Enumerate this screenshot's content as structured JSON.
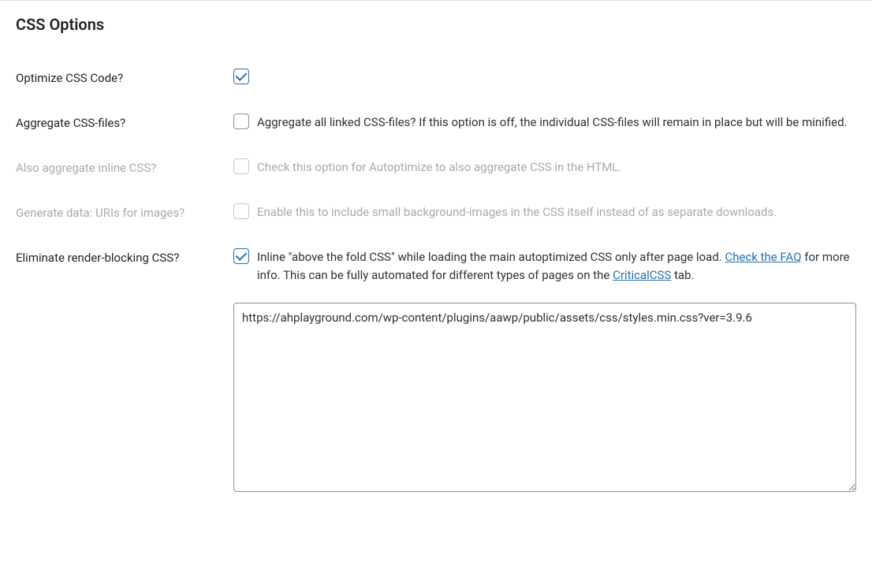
{
  "section": {
    "title": "CSS Options"
  },
  "rows": {
    "optimize": {
      "label": "Optimize CSS Code?"
    },
    "aggregate": {
      "label": "Aggregate CSS-files?",
      "desc": "Aggregate all linked CSS-files? If this option is off, the individual CSS-files will remain in place but will be minified."
    },
    "inline": {
      "label": "Also aggregate inline CSS?",
      "desc": "Check this option for Autoptimize to also aggregate CSS in the HTML."
    },
    "datauri": {
      "label": "Generate data: URIs for images?",
      "desc": "Enable this to include small background-images in the CSS itself instead of as separate downloads."
    },
    "eliminate": {
      "label": "Eliminate render-blocking CSS?",
      "desc_part1": "Inline \"above the fold CSS\" while loading the main autoptimized CSS only after page load. ",
      "link1": "Check the FAQ",
      "desc_part2": " for more info. This can be fully automated for different types of pages on the ",
      "link2": "CriticalCSS",
      "desc_part3": " tab."
    },
    "textarea": {
      "value": "https://ahplayground.com/wp-content/plugins/aawp/public/assets/css/styles.min.css?ver=3.9.6"
    }
  }
}
